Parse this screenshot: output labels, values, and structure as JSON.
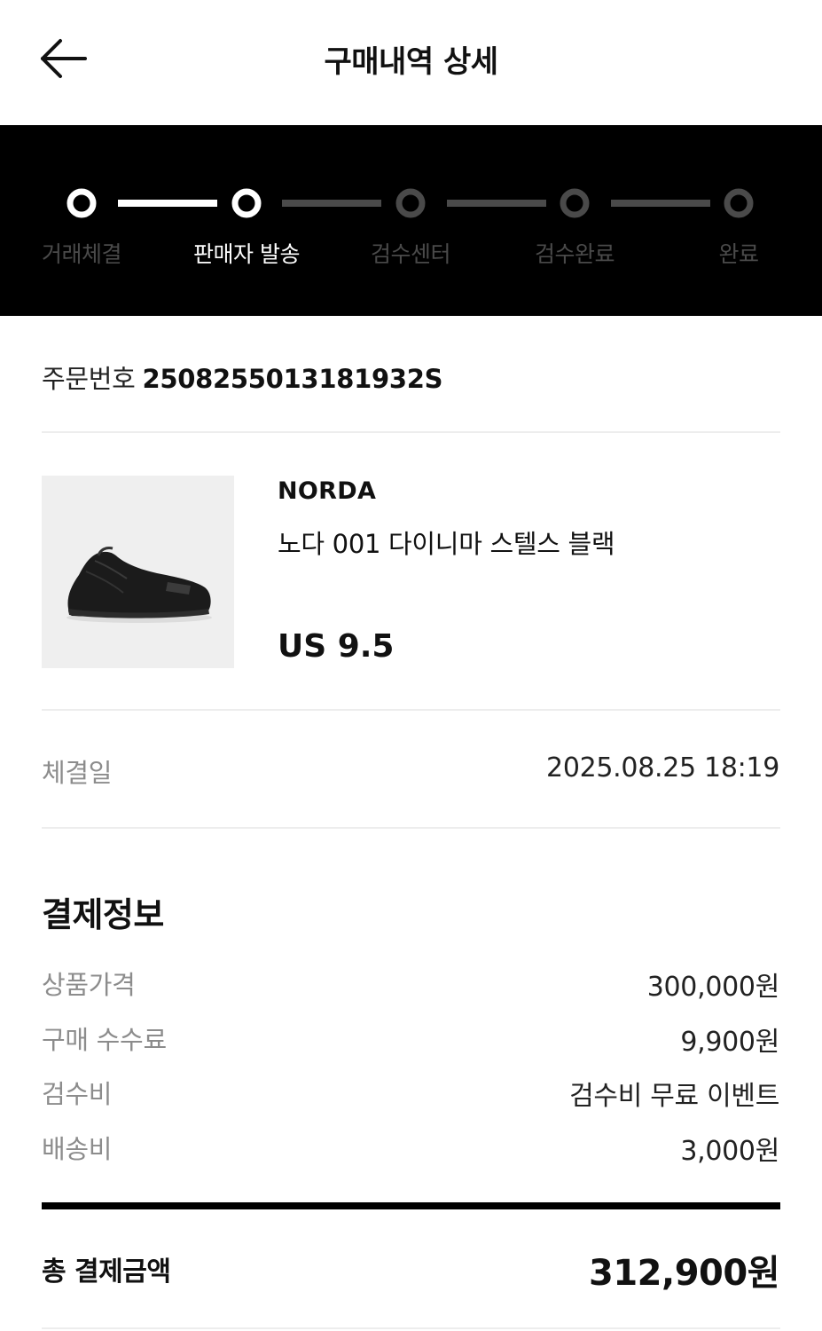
{
  "header": {
    "title": "구매내역 상세",
    "back_icon": "arrow-left-icon"
  },
  "progress": {
    "current_step": 2,
    "steps": [
      {
        "label": "거래체결",
        "state": "done"
      },
      {
        "label": "판매자 발송",
        "state": "current"
      },
      {
        "label": "검수센터",
        "state": "pending"
      },
      {
        "label": "검수완료",
        "state": "pending"
      },
      {
        "label": "완료",
        "state": "pending"
      }
    ]
  },
  "order": {
    "number_label": "주문번호",
    "number_value": "2508255013181932S"
  },
  "product": {
    "brand": "NORDA",
    "name": "노다 001 다이니마 스텔스 블랙",
    "size": "US 9.5",
    "image_icon": "sneaker-image"
  },
  "trade": {
    "date_label": "체결일",
    "date_value": "2025.08.25 18:19"
  },
  "payment": {
    "title": "결제정보",
    "rows": [
      {
        "label": "상품가격",
        "value": "300,000원"
      },
      {
        "label": "구매 수수료",
        "value": "9,900원"
      },
      {
        "label": "검수비",
        "value": "검수비 무료 이벤트"
      },
      {
        "label": "배송비",
        "value": "3,000원"
      }
    ],
    "total_label": "총 결제금액",
    "total_value": "312,900원"
  },
  "colors": {
    "progress_bg": "#000000",
    "active": "#ffffff",
    "inactive": "#4a4a4a",
    "muted_text": "#8c8c8c"
  }
}
